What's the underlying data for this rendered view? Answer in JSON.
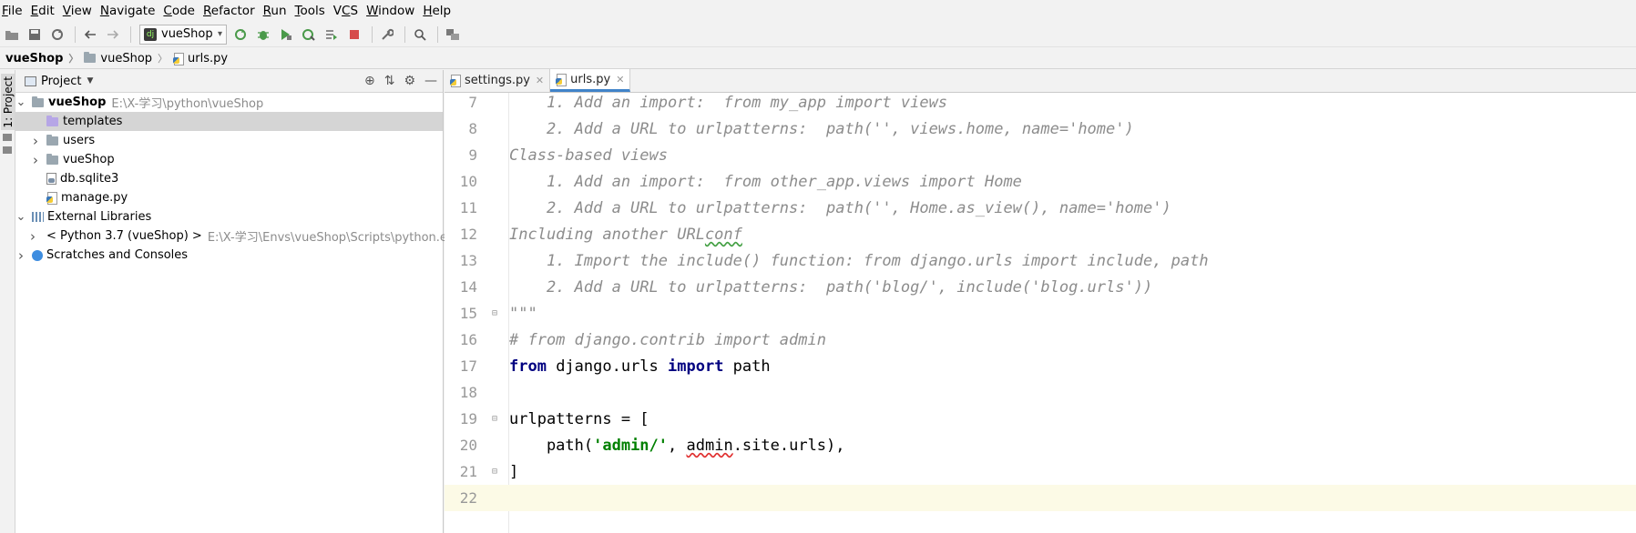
{
  "menu": [
    {
      "label": "File",
      "mnemonic_index": 0
    },
    {
      "label": "Edit",
      "mnemonic_index": 0
    },
    {
      "label": "View",
      "mnemonic_index": 0
    },
    {
      "label": "Navigate",
      "mnemonic_index": 0
    },
    {
      "label": "Code",
      "mnemonic_index": 0
    },
    {
      "label": "Refactor",
      "mnemonic_index": 0
    },
    {
      "label": "Run",
      "mnemonic_index": 0
    },
    {
      "label": "Tools",
      "mnemonic_index": 0
    },
    {
      "label": "VCS",
      "mnemonic_index": 1
    },
    {
      "label": "Window",
      "mnemonic_index": 0
    },
    {
      "label": "Help",
      "mnemonic_index": 0
    }
  ],
  "toolbar": {
    "run_config_label": "vueShop"
  },
  "breadcrumbs": [
    {
      "label": "vueShop",
      "icon": "none"
    },
    {
      "label": "vueShop",
      "icon": "folder-icon"
    },
    {
      "label": "urls.py",
      "icon": "python-file-icon"
    }
  ],
  "tool_strip": {
    "project_tab": "1: Project"
  },
  "project_panel": {
    "title": "Project",
    "tree": [
      {
        "name": "vueShop",
        "path": "E:\\X-学习\\python\\vueShop",
        "expanded": true,
        "level": 0,
        "icon": "folder-icon",
        "bold": true
      },
      {
        "name": "templates",
        "level": 1,
        "icon": "folder-purple-icon",
        "selected": true
      },
      {
        "name": "users",
        "level": 1,
        "icon": "folder-icon",
        "collapsed": true
      },
      {
        "name": "vueShop",
        "level": 1,
        "icon": "folder-icon",
        "collapsed": true
      },
      {
        "name": "db.sqlite3",
        "level": 1,
        "icon": "database-file-icon"
      },
      {
        "name": "manage.py",
        "level": 1,
        "icon": "python-file-icon"
      },
      {
        "name": "External Libraries",
        "level": 0,
        "icon": "library-icon",
        "expanded": true
      },
      {
        "name": "< Python 3.7 (vueShop) >",
        "path": "E:\\X-学习\\Envs\\vueShop\\Scripts\\python.exe",
        "level": 1,
        "icon": "python-icon",
        "collapsed": true
      },
      {
        "name": "Scratches and Consoles",
        "level": 0,
        "icon": "scratch-icon",
        "collapsed": true
      }
    ]
  },
  "editor": {
    "tabs": [
      {
        "label": "settings.py",
        "active": false
      },
      {
        "label": "urls.py",
        "active": true
      }
    ],
    "lines": [
      {
        "num": "7",
        "text": "    1. Add an import:  from my_app import views"
      },
      {
        "num": "8",
        "text": "    2. Add a URL to urlpatterns:  path('', views.home, name='home')"
      },
      {
        "num": "9",
        "text": "Class-based views"
      },
      {
        "num": "10",
        "text": "    1. Add an import:  from other_app.views import Home"
      },
      {
        "num": "11",
        "text": "    2. Add a URL to urlpatterns:  path('', Home.as_view(), name='home')"
      },
      {
        "num": "12",
        "text": "Including another URLconf"
      },
      {
        "num": "13",
        "text": "    1. Import the include() function: from django.urls import include, path"
      },
      {
        "num": "14",
        "text": "    2. Add a URL to urlpatterns:  path('blog/', include('blog.urls'))"
      },
      {
        "num": "15",
        "text": "\"\"\""
      },
      {
        "num": "16",
        "text": "# from django.contrib import admin"
      },
      {
        "num": "17",
        "text": "from django.urls import path"
      },
      {
        "num": "18",
        "text": ""
      },
      {
        "num": "19",
        "text": "urlpatterns = ["
      },
      {
        "num": "20",
        "text": "    path('admin/', admin.site.urls),"
      },
      {
        "num": "21",
        "text": "]"
      },
      {
        "num": "22",
        "text": ""
      }
    ]
  }
}
